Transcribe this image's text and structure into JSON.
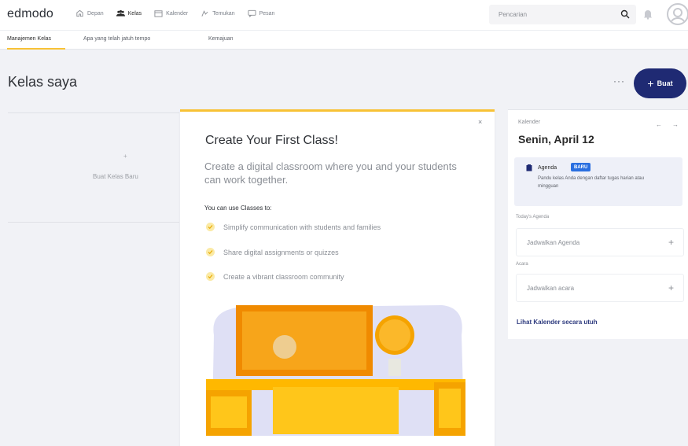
{
  "app": {
    "logo": "edmodo"
  },
  "nav": {
    "items": [
      {
        "label": "Depan",
        "icon": "home-icon",
        "active": false
      },
      {
        "label": "Kelas",
        "icon": "classes-icon",
        "active": true
      },
      {
        "label": "Kalender",
        "icon": "calendar-icon",
        "active": false
      },
      {
        "label": "Temukan",
        "icon": "discover-icon",
        "active": false
      },
      {
        "label": "Pesan",
        "icon": "messages-icon",
        "active": false
      }
    ]
  },
  "search": {
    "placeholder": "Pencarian"
  },
  "subtabs": [
    {
      "label": "Manajemen Kelas",
      "active": true
    },
    {
      "label": "Apa yang telah jatuh tempo",
      "active": false
    },
    {
      "label": "Kemajuan",
      "active": false
    }
  ],
  "page": {
    "title": "Kelas saya",
    "more": "···",
    "create_plus": "+",
    "create_label": "Buat"
  },
  "new_class": {
    "plus": "+",
    "label": "Buat Kelas Baru"
  },
  "popup": {
    "close": "×",
    "title": "Create Your First Class!",
    "subtitle": "Create a digital classroom where you and your students can work together.",
    "uses_title": "You can use Classes to:",
    "bullets": [
      "Simplify communication with students and families",
      "Share digital assignments or quizzes",
      "Create a vibrant classroom community"
    ]
  },
  "calendar": {
    "label": "Kalender",
    "date": "Senin, April 12",
    "prev": "←",
    "next": "→",
    "agenda": {
      "title": "Agenda",
      "badge": "BARU",
      "description": "Pandu kelas Anda dengan daftar tugas harian atau mingguan"
    },
    "todays_agenda_label": "Today's Agenda",
    "schedule_agenda": "Jadwalkan Agenda",
    "events_label": "Acara",
    "schedule_event": "Jadwalkan acara",
    "row_plus": "+",
    "view_all": "Lihat Kalender secara utuh"
  },
  "colors": {
    "accent": "#f8c235",
    "primary": "#1f2a73",
    "badge": "#2a6fe0",
    "background": "#f1f2f6"
  }
}
